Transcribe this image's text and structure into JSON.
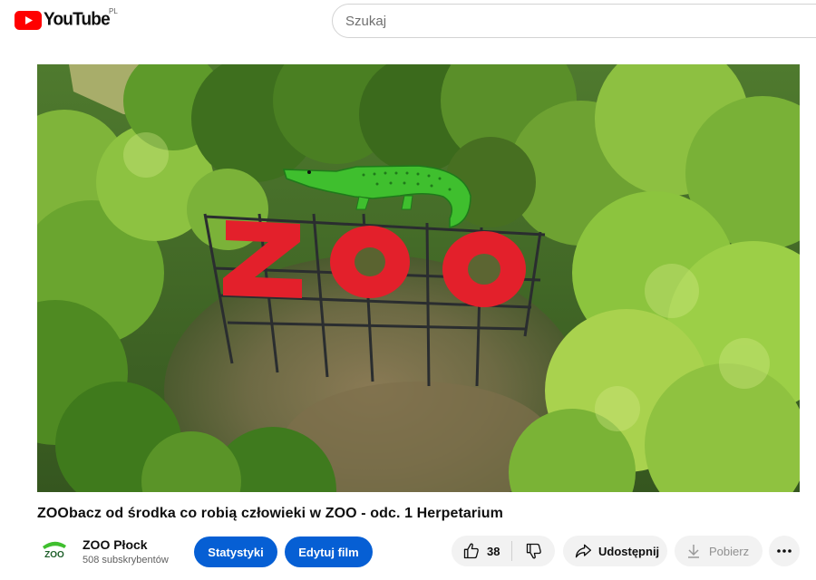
{
  "header": {
    "logo_text": "YouTube",
    "region": "PL",
    "search_placeholder": "Szukaj"
  },
  "video": {
    "sign_text": "ZOO",
    "title": "ZOObacz od środka co robią człowieki w ZOO - odc. 1 Herpetarium"
  },
  "channel": {
    "name": "ZOO Płock",
    "subscribers": "508 subskrybentów",
    "avatar_text": "ZOO"
  },
  "actions": {
    "stats_label": "Statystyki",
    "edit_label": "Edytuj film",
    "like_count": "38",
    "share_label": "Udostępnij",
    "download_label": "Pobierz"
  },
  "colors": {
    "youtube_red": "#ff0000",
    "button_blue": "#065fd4",
    "pill_grey": "#f2f2f2",
    "sign_red": "#e3202b",
    "crocodile_green": "#3fbf2e"
  },
  "icons": [
    "youtube-logo-icon",
    "like-icon",
    "dislike-icon",
    "share-icon",
    "download-icon",
    "more-icon"
  ]
}
